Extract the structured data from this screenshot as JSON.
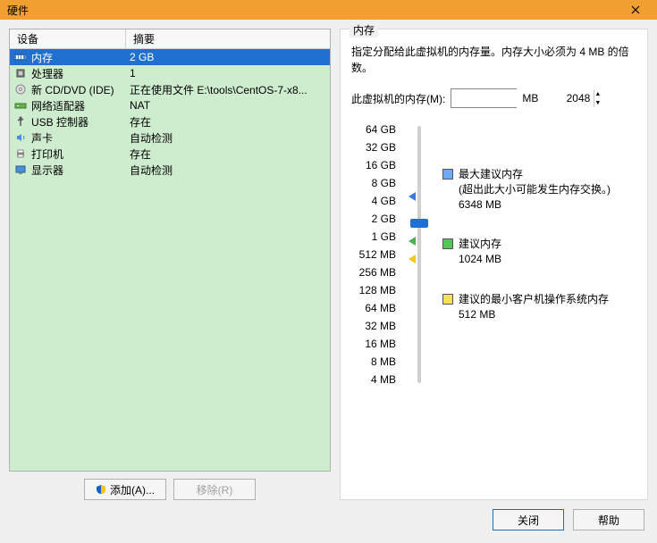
{
  "window": {
    "title": "硬件"
  },
  "device_header": {
    "col1": "设备",
    "col2": "摘要"
  },
  "devices": [
    {
      "icon": "memory",
      "name": "内存",
      "summary": "2 GB",
      "selected": true
    },
    {
      "icon": "cpu",
      "name": "处理器",
      "summary": "1"
    },
    {
      "icon": "cd",
      "name": "新 CD/DVD (IDE)",
      "summary": "正在使用文件 E:\\tools\\CentOS-7-x8..."
    },
    {
      "icon": "net",
      "name": "网络适配器",
      "summary": "NAT"
    },
    {
      "icon": "usb",
      "name": "USB 控制器",
      "summary": "存在"
    },
    {
      "icon": "sound",
      "name": "声卡",
      "summary": "自动检测"
    },
    {
      "icon": "printer",
      "name": "打印机",
      "summary": "存在"
    },
    {
      "icon": "display",
      "name": "显示器",
      "summary": "自动检测"
    }
  ],
  "buttons": {
    "add": "添加(A)...",
    "remove": "移除(R)",
    "close": "关闭",
    "help": "帮助"
  },
  "memory": {
    "group_title": "内存",
    "description": "指定分配给此虚拟机的内存量。内存大小必须为 4 MB 的倍数。",
    "input_label": "此虚拟机的内存(M):",
    "value": "2048",
    "unit": "MB",
    "ticks": [
      "64 GB",
      "32 GB",
      "16 GB",
      "8 GB",
      "4 GB",
      "2 GB",
      "1 GB",
      "512 MB",
      "256 MB",
      "128 MB",
      "64 MB",
      "32 MB",
      "16 MB",
      "8 MB",
      "4 MB"
    ],
    "current_index": 5,
    "markers": {
      "blue_index": 3.5,
      "green_index": 6,
      "yellow_index": 7
    },
    "legend": {
      "max": {
        "title": "最大建议内存",
        "note": "(超出此大小可能发生内存交换。)",
        "value": "6348 MB"
      },
      "rec": {
        "title": "建议内存",
        "value": "1024 MB"
      },
      "min": {
        "title": "建议的最小客户机操作系统内存",
        "value": "512 MB"
      }
    }
  }
}
